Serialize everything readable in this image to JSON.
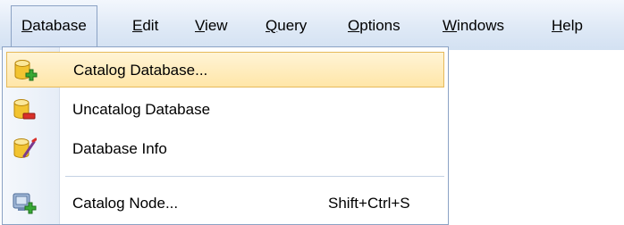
{
  "menubar": {
    "items": [
      {
        "label_u": "D",
        "label_rest": "atabase",
        "active": true
      },
      {
        "label_u": "E",
        "label_rest": "dit"
      },
      {
        "label_u": "V",
        "label_rest": "iew"
      },
      {
        "label_u": "Q",
        "label_rest": "uery"
      },
      {
        "label_u": "O",
        "label_rest": "ptions"
      },
      {
        "label_u": "W",
        "label_rest": "indows"
      },
      {
        "label_u": "H",
        "label_rest": "elp"
      }
    ]
  },
  "database_menu": {
    "items": [
      {
        "label": "Catalog Database...",
        "icon": "database-add-icon",
        "highlighted": true
      },
      {
        "label": "Uncatalog Database",
        "icon": "database-remove-icon"
      },
      {
        "label": "Database Info",
        "icon": "database-info-icon"
      },
      {
        "label": "Catalog Node...",
        "icon": "node-add-icon",
        "shortcut": "Shift+Ctrl+S"
      }
    ]
  },
  "colors": {
    "highlight_bg": "#ffe6a8",
    "highlight_border": "#e6b95a",
    "menubar_bg": "#dfe9f6",
    "db_yellow": "#f2c431",
    "add_green": "#38a935",
    "remove_red": "#d9302a"
  }
}
